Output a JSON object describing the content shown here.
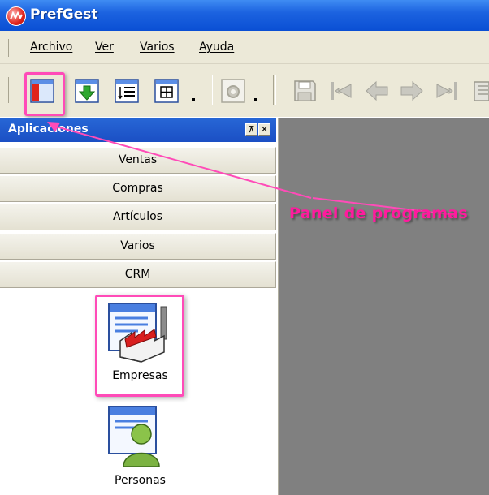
{
  "window": {
    "title": "PrefGest"
  },
  "menu": [
    "Archivo",
    "Ver",
    "Varios",
    "Ayuda"
  ],
  "panel": {
    "title": "Aplicaciones",
    "pin_glyph": "⊼",
    "close_glyph": "✕",
    "groups": [
      "Ventas",
      "Compras",
      "Artículos",
      "Varios",
      "CRM"
    ],
    "items": [
      {
        "label": "Empresas",
        "icon": "factory-icon"
      },
      {
        "label": "Personas",
        "icon": "person-icon"
      }
    ]
  },
  "annotation": {
    "text": "Panel de programas",
    "color": "#ff1a9e"
  },
  "colors": {
    "titlebar": "#0a4fd4",
    "highlight": "#ff4bb8",
    "workspace": "#808080",
    "chrome": "#ece9d8"
  },
  "toolbar_icons": [
    "panel-icon",
    "download-icon",
    "list-icon",
    "grid-icon",
    "settings-icon",
    "save-icon",
    "first-record-icon",
    "previous-record-icon",
    "next-record-icon",
    "last-record-icon"
  ]
}
